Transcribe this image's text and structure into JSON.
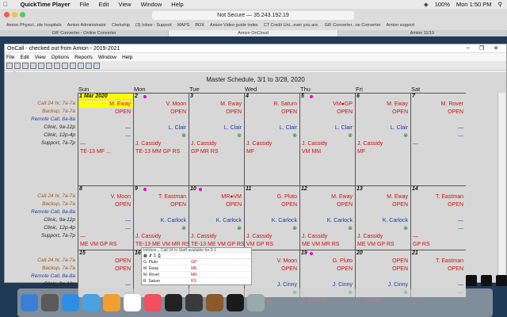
{
  "mac_menu": {
    "app": "QuickTime Player",
    "items": [
      "File",
      "Edit",
      "View",
      "Window",
      "Help"
    ],
    "battery": "100%",
    "time": "Mon 1:50 PM"
  },
  "browser": {
    "address": "Not Secure — 35.243.192.19",
    "bookmarks": [
      "Amion Physici...ide hospitals",
      "Amion Administrator",
      "Clerkship",
      "(3) Inbox - Support",
      "MAPS",
      "BOX",
      "Amion Video guide index",
      "CT Credit Uni...ever you are.",
      "GIF Converter...ne Converter",
      "Amion support"
    ],
    "tabs": [
      {
        "label": "GIF Converter - Online Converter"
      },
      {
        "label": "Amion OnCloud"
      },
      {
        "label": "Amion 11/19"
      }
    ],
    "tab_count": "33"
  },
  "app": {
    "title": "OnCall - checked out from Amion - 2019-2021",
    "menu": [
      "File",
      "Edit",
      "View",
      "Options",
      "Reports",
      "Window",
      "Help"
    ],
    "schedule_title": "Master Schedule, 3/1 to 3/28, 2020",
    "days": [
      "Sun",
      "Mon",
      "Tue",
      "Wed",
      "Thu",
      "Fri",
      "Sat"
    ],
    "row_labels": [
      "Call 24 hr, 7a-7a",
      "Backup, 7a-7a",
      "Remote Call, 8a-8a",
      "Clinic, 9a-12p",
      "Clinic, 12p-4p",
      "Support, 7a-7p"
    ],
    "weeks": [
      {
        "dates": [
          "1 Mar 2020",
          "2",
          "3",
          "4",
          "5",
          "6",
          "7"
        ],
        "rows": [
          [
            "M. Eway",
            "V. Moon",
            "M. Eway",
            "R. Saturn",
            "VM●GP",
            "M. Eway",
            "M. Rover"
          ],
          [
            "OPEN",
            "OPEN",
            "OPEN",
            "OPEN",
            "OPEN",
            "OPEN",
            "OPEN"
          ],
          [
            "",
            "",
            "",
            "",
            "",
            "",
            ""
          ],
          [
            "—",
            "L. Clair",
            "L. Clair",
            "L. Clair",
            "L. Clair",
            "L. Clair",
            "—"
          ],
          [
            "—",
            "⊗",
            "⊗",
            "⊗",
            "⊗",
            "⊗",
            "—"
          ],
          [
            "—",
            "J. Cassidy",
            "J. Cassidy",
            "J. Cassidy",
            "J. Cassidy",
            "J. Cassidy",
            "—"
          ]
        ],
        "extra": [
          "TE-13 MF ...",
          "TE-13 MM GP RS",
          "GP MR RS",
          "MF",
          "VM MM",
          "MF",
          ""
        ]
      },
      {
        "dates": [
          "8",
          "9",
          "10",
          "11",
          "12",
          "13",
          "14"
        ],
        "rows": [
          [
            "V. Moon",
            "T. Eastman",
            "MR●VM",
            "G. Pluto",
            "M. Eway",
            "M. Eway",
            "T. Eastman"
          ],
          [
            "OPEN",
            "OPEN",
            "OPEN",
            "OPEN",
            "OPEN",
            "OPEN",
            "OPEN"
          ],
          [
            "",
            "",
            "",
            "",
            "",
            "",
            ""
          ],
          [
            "—",
            "K. Carlock",
            "K. Carlock",
            "K. Carlock",
            "K. Carlock",
            "K. Carlock",
            "—"
          ],
          [
            "—",
            "⊗",
            "⊗",
            "⊗",
            "⊗",
            "⊗",
            "—"
          ],
          [
            "—",
            "J. Cassidy",
            "J. Cassidy",
            "J. Cassidy",
            "J. Cassidy",
            "J. Cassidy",
            "—"
          ]
        ],
        "extra": [
          "ME VM GP RS",
          "TE-13 ME VM MR RS",
          "TE-13 ME VM GP RS",
          "VM GP RS",
          "ME VM MR RS",
          "ME VM GP RS",
          "GP RS"
        ]
      },
      {
        "dates": [
          "15",
          "16",
          "17",
          "18",
          "19",
          "20",
          "21"
        ],
        "rows": [
          [
            "OPEN",
            "",
            "",
            "V. Moon",
            "G. Pluto",
            "OPEN",
            "T. Eastman"
          ],
          [
            "OPEN",
            "",
            "",
            "OPEN",
            "OPEN",
            "OPEN",
            "OPEN"
          ],
          [
            "",
            "",
            "",
            "",
            "",
            "",
            ""
          ],
          [
            "—",
            "",
            "",
            "J. Cinny",
            "J. Cinny",
            "J. Cinny",
            "—"
          ],
          [
            "—",
            "",
            "",
            "⊗",
            "⊗",
            "⊗",
            "—"
          ],
          [
            "—",
            "",
            "",
            "J. Cassidy",
            "J. Cassidy",
            "J. Cassidy",
            "—"
          ]
        ],
        "extra": [
          "",
          "",
          "",
          "",
          "",
          "",
          ""
        ]
      }
    ],
    "popup": {
      "title": "Infobox... Call 24 hr Staff available for 3-1",
      "rows": [
        {
          "name": "G. Pluto",
          "code": "GP"
        },
        {
          "name": "M. Eway",
          "code": "ME"
        },
        {
          "name": "M. Rover",
          "code": "MR"
        },
        {
          "name": "R. Saturn",
          "code": "RS"
        }
      ]
    }
  },
  "colors": {
    "call": "#cc1111",
    "remote": "#2233aa",
    "clinic": "#2233aa",
    "support": "#2a7a2a",
    "highlight": "#ffff00"
  },
  "dock_icons": [
    "finder-icon",
    "launchpad-icon",
    "safari-icon",
    "mail-icon",
    "photos-icon",
    "calendar-icon",
    "music-icon",
    "terminal-icon",
    "quicktime-icon",
    "chess-icon",
    "tv-icon",
    "trash-icon"
  ]
}
